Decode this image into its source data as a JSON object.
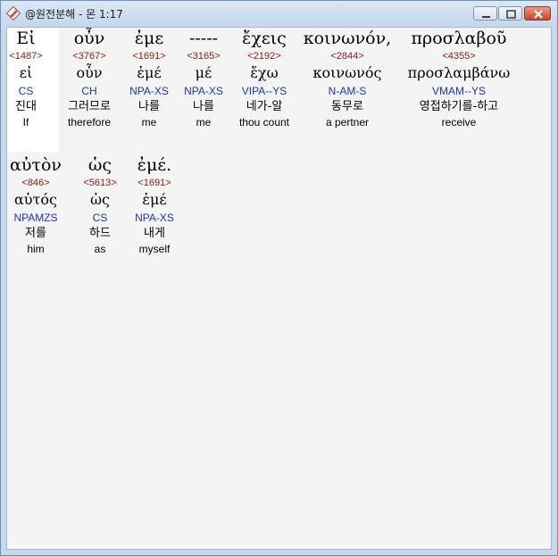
{
  "window": {
    "title": "@원전분해 - 몬 1:17"
  },
  "words": [
    {
      "greek": "Εἰ",
      "strong": "<1487>",
      "lexical": "εἰ",
      "parse": "CS",
      "korean": "진대",
      "english": "If"
    },
    {
      "greek": "οὖν",
      "strong": "<3767>",
      "lexical": "οὖν",
      "parse": "CH",
      "korean": "그러므로",
      "english": "therefore"
    },
    {
      "greek": "ἐμε",
      "strong": "<1691>",
      "lexical": "ἐμέ",
      "parse": "NPA-XS",
      "korean": "나를",
      "english": "me"
    },
    {
      "greek": "-----",
      "strong": "<3165>",
      "lexical": "μέ",
      "parse": "NPA-XS",
      "korean": "나를",
      "english": "me"
    },
    {
      "greek": "ἔχεις",
      "strong": "<2192>",
      "lexical": "ἔχω",
      "parse": "VIPA--YS",
      "korean": "네가-알",
      "english": "thou count"
    },
    {
      "greek": "κοινωνόν,",
      "strong": "<2844>",
      "lexical": "κοινωνός",
      "parse": "N-AM-S",
      "korean": "동무로",
      "english": "a pertner"
    },
    {
      "greek": "προσλαβοῦ",
      "strong": "<4355>",
      "lexical": "προσλαμβάνω",
      "parse": "VMAM--YS",
      "korean": "영접하기를-하고",
      "english": "receive"
    },
    {
      "greek": "αὐτὸν",
      "strong": "<846>",
      "lexical": "αὐτός",
      "parse": "NPAMZS",
      "korean": "저를",
      "english": "him"
    },
    {
      "greek": "ὡς",
      "strong": "<5613>",
      "lexical": "ὡς",
      "parse": "CS",
      "korean": "하드",
      "english": "as"
    },
    {
      "greek": "ἐμέ.",
      "strong": "<1691>",
      "lexical": "ἐμέ",
      "parse": "NPA-XS",
      "korean": "내게",
      "english": "myself"
    }
  ]
}
